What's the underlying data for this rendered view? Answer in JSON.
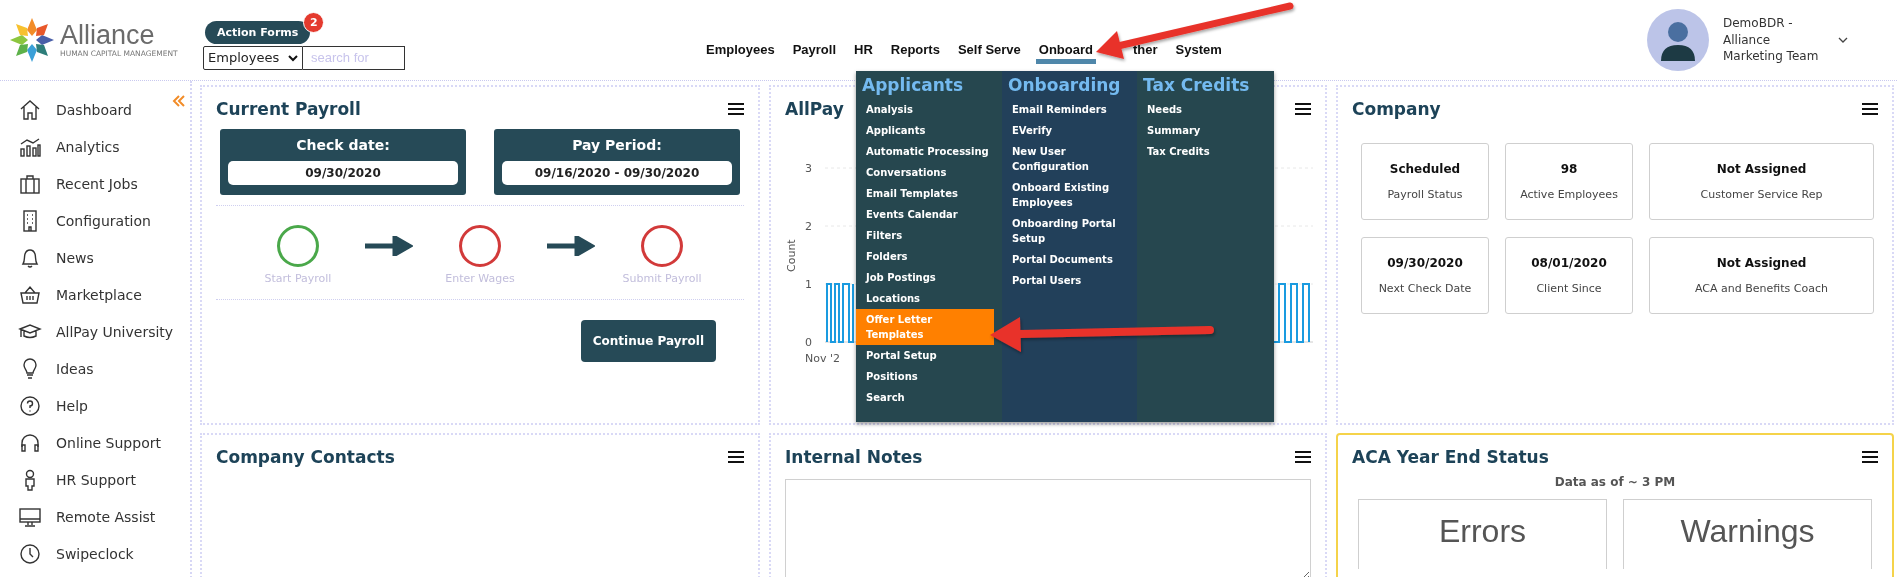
{
  "brand": {
    "name": "Alliance",
    "tagline": "HUMAN CAPITAL MANAGEMENT"
  },
  "action_forms": {
    "label": "Action Forms",
    "badge": "2"
  },
  "search": {
    "scope": "Employees",
    "placeholder": "search for"
  },
  "nav": [
    {
      "label": "Employees",
      "selected": false
    },
    {
      "label": "Payroll",
      "selected": false
    },
    {
      "label": "HR",
      "selected": false
    },
    {
      "label": "Reports",
      "selected": false
    },
    {
      "label": "Self Serve",
      "selected": false
    },
    {
      "label": "Onboard",
      "selected": true
    },
    {
      "label": "ther",
      "selected": false
    },
    {
      "label": "System",
      "selected": false
    }
  ],
  "user": {
    "name": "DemoBDR - Alliance Marketing Team"
  },
  "sidebar": {
    "items": [
      {
        "label": "Dashboard"
      },
      {
        "label": "Analytics"
      },
      {
        "label": "Recent Jobs"
      },
      {
        "label": "Configuration"
      },
      {
        "label": "News"
      },
      {
        "label": "Marketplace"
      },
      {
        "label": "AllPay University"
      },
      {
        "label": "Ideas"
      },
      {
        "label": "Help"
      },
      {
        "label": "Online Support"
      },
      {
        "label": "HR Support"
      },
      {
        "label": "Remote Assist"
      },
      {
        "label": "Swipeclock"
      }
    ]
  },
  "current_payroll": {
    "title": "Current Payroll",
    "dates": [
      {
        "label": "Check date:",
        "value": "09/30/2020"
      },
      {
        "label": "Pay Period:",
        "value": "09/16/2020 - 09/30/2020"
      }
    ],
    "steps": [
      {
        "label": "Start Payroll",
        "complete": true
      },
      {
        "label": "Enter Wages",
        "complete": false
      },
      {
        "label": "Submit Payroll",
        "complete": false
      }
    ],
    "button": "Continue Payroll"
  },
  "allpay_card": {
    "title": "AllPay",
    "chart": {
      "ylabel": "Count",
      "yticks": [
        "3",
        "2",
        "1",
        "0"
      ],
      "xtick": "Nov '2"
    }
  },
  "company": {
    "title": "Company",
    "tiles": [
      {
        "value": "Scheduled",
        "label": "Payroll Status"
      },
      {
        "value": "98",
        "label": "Active Employees"
      },
      {
        "value": "Not Assigned",
        "label": "Customer Service Rep"
      },
      {
        "value": "09/30/2020",
        "label": "Next Check Date"
      },
      {
        "value": "08/01/2020",
        "label": "Client Since"
      },
      {
        "value": "Not Assigned",
        "label": "ACA and Benefits Coach"
      }
    ]
  },
  "company_contacts": {
    "title": "Company Contacts"
  },
  "internal_notes": {
    "title": "Internal Notes"
  },
  "aca": {
    "title": "ACA Year End Status",
    "note": "Data as of ~ 3 PM",
    "tiles": [
      "Errors",
      "Warnings"
    ]
  },
  "menu": {
    "columns": [
      {
        "heading": "Applicants",
        "items": [
          {
            "label": "Analysis",
            "selected": false
          },
          {
            "label": "Applicants",
            "selected": false
          },
          {
            "label": "Automatic Processing",
            "selected": false
          },
          {
            "label": "Conversations",
            "selected": false
          },
          {
            "label": "Email Templates",
            "selected": false
          },
          {
            "label": "Events Calendar",
            "selected": false
          },
          {
            "label": "Filters",
            "selected": false
          },
          {
            "label": "Folders",
            "selected": false
          },
          {
            "label": "Job Postings",
            "selected": false
          },
          {
            "label": "Locations",
            "selected": false
          },
          {
            "label": "Offer Letter Templates",
            "selected": true
          },
          {
            "label": "Portal Setup",
            "selected": false
          },
          {
            "label": "Positions",
            "selected": false
          },
          {
            "label": "Search",
            "selected": false
          }
        ]
      },
      {
        "heading": "Onboarding",
        "items": [
          {
            "label": "Email Reminders",
            "selected": false
          },
          {
            "label": "EVerify",
            "selected": false
          },
          {
            "label": "New User Configuration",
            "selected": false
          },
          {
            "label": "Onboard Existing Employees",
            "selected": false
          },
          {
            "label": "Onboarding Portal Setup",
            "selected": false
          },
          {
            "label": "Portal Documents",
            "selected": false
          },
          {
            "label": "Portal Users",
            "selected": false
          }
        ]
      },
      {
        "heading": "Tax Credits",
        "items": [
          {
            "label": "Needs",
            "selected": false
          },
          {
            "label": "Summary",
            "selected": false
          },
          {
            "label": "Tax Credits",
            "selected": false
          }
        ]
      }
    ]
  }
}
